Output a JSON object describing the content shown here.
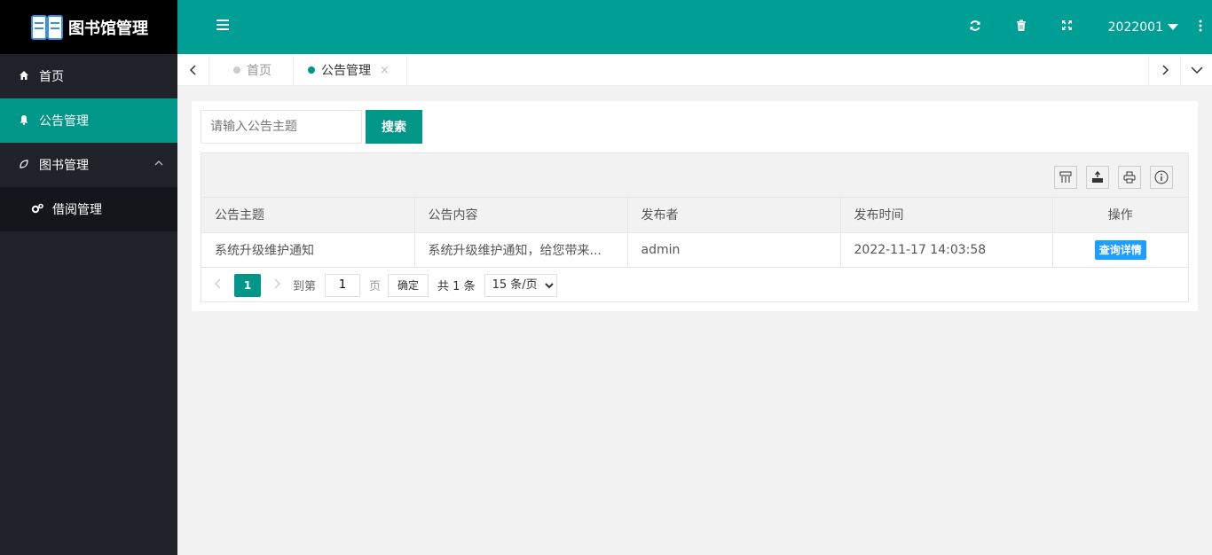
{
  "app": {
    "title": "图书馆管理"
  },
  "sidebar": {
    "items": [
      {
        "label": "首页",
        "icon": "home-icon"
      },
      {
        "label": "公告管理",
        "icon": "bell-icon",
        "active": true
      },
      {
        "label": "图书管理",
        "icon": "leaf-icon",
        "expanded": true
      },
      {
        "label": "借阅管理",
        "icon": "gears-icon",
        "sub": true
      }
    ]
  },
  "header": {
    "icons": [
      "refresh-icon",
      "trash-icon",
      "fullscreen-icon"
    ],
    "user": "2022001"
  },
  "tabs": [
    {
      "label": "首页",
      "dot_color": "#cccccc"
    },
    {
      "label": "公告管理",
      "dot_color": "#009688",
      "active": true,
      "close": "×"
    }
  ],
  "search": {
    "placeholder": "请输入公告主题",
    "button": "搜索"
  },
  "table": {
    "columns": [
      "公告主题",
      "公告内容",
      "发布者",
      "发布时间",
      "操作"
    ],
    "rows": [
      {
        "title": "系统升级维护通知",
        "content": "系统升级维护通知，给您带来...",
        "publisher": "admin",
        "time": "2022-11-17 14:03:58",
        "action": "查询详情"
      }
    ]
  },
  "pager": {
    "current": "1",
    "goto_label": "到第",
    "goto_value": "1",
    "page_unit": "页",
    "confirm": "确定",
    "total": "共 1 条",
    "page_size": "15 条/页"
  },
  "colors": {
    "primary": "#009688",
    "header": "#009f95",
    "sidebar": "#20222a",
    "action_button": "#1e9fff"
  }
}
